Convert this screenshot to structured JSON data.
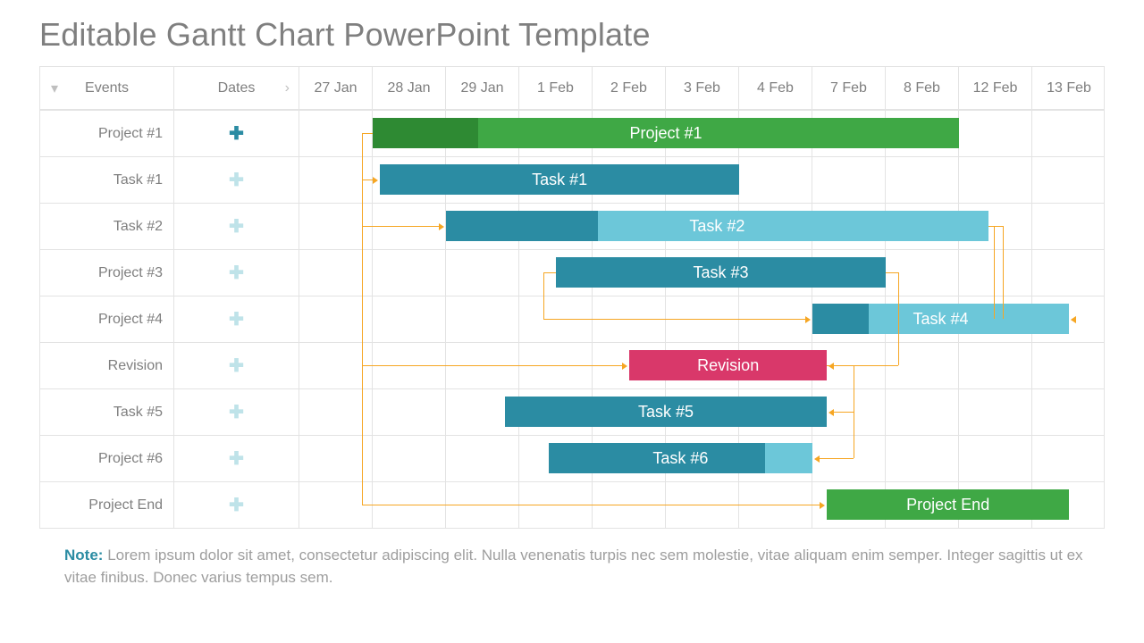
{
  "title": "Editable Gantt Chart PowerPoint Template",
  "headers": {
    "events": "Events",
    "dates": "Dates",
    "cols": [
      "27 Jan",
      "28 Jan",
      "29 Jan",
      "1 Feb",
      "2 Feb",
      "3 Feb",
      "4 Feb",
      "7 Feb",
      "8 Feb",
      "12 Feb",
      "13 Feb"
    ]
  },
  "rows": [
    {
      "label": "Project #1",
      "plus": "teal"
    },
    {
      "label": "Task #1",
      "plus": "light"
    },
    {
      "label": "Task #2",
      "plus": "light"
    },
    {
      "label": "Project #3",
      "plus": "light"
    },
    {
      "label": "Project #4",
      "plus": "light"
    },
    {
      "label": "Revision",
      "plus": "light"
    },
    {
      "label": "Task #5",
      "plus": "light"
    },
    {
      "label": "Project #6",
      "plus": "light"
    },
    {
      "label": "Project End",
      "plus": "light"
    }
  ],
  "colors": {
    "green": "#3fa845",
    "green_dark": "#2e8a33",
    "teal": "#2b8ca3",
    "teal_light": "#6cc7d9",
    "magenta": "#d9386a",
    "orange": "#f6a623"
  },
  "chart_data": {
    "type": "bar",
    "title": "Editable Gantt Chart PowerPoint Template",
    "categories": [
      "27 Jan",
      "28 Jan",
      "29 Jan",
      "1 Feb",
      "2 Feb",
      "3 Feb",
      "4 Feb",
      "7 Feb",
      "8 Feb",
      "12 Feb",
      "13 Feb"
    ],
    "xlabel": "Dates",
    "ylabel": "Events",
    "series": [
      {
        "name": "Project #1",
        "row": 0,
        "start_col": 1.0,
        "end_col": 9.0,
        "label": "Project #1",
        "fill": "green",
        "progress_fill": "green_dark",
        "progress": 0.18
      },
      {
        "name": "Task #1",
        "row": 1,
        "start_col": 1.1,
        "end_col": 6.0,
        "label": "Task #1",
        "fill": "teal"
      },
      {
        "name": "Task #2",
        "row": 2,
        "start_col": 2.0,
        "end_col": 9.4,
        "label": "Task #2",
        "fill": "teal_light",
        "progress_fill": "teal",
        "progress": 0.28
      },
      {
        "name": "Task #3",
        "row": 3,
        "start_col": 3.5,
        "end_col": 8.0,
        "label": "Task #3",
        "fill": "teal"
      },
      {
        "name": "Task #4",
        "row": 4,
        "start_col": 7.0,
        "end_col": 10.5,
        "label": "Task #4",
        "fill": "teal_light",
        "progress_fill": "teal",
        "progress": 0.22
      },
      {
        "name": "Revision",
        "row": 5,
        "start_col": 4.5,
        "end_col": 7.2,
        "label": "Revision",
        "fill": "magenta"
      },
      {
        "name": "Task #5",
        "row": 6,
        "start_col": 2.8,
        "end_col": 7.2,
        "label": "Task #5",
        "fill": "teal"
      },
      {
        "name": "Task #6",
        "row": 7,
        "start_col": 3.4,
        "end_col": 7.0,
        "label": "Task #6",
        "fill": "teal",
        "overlay_fill": "teal_light",
        "overlay_from": 0.82
      },
      {
        "name": "Project End",
        "row": 8,
        "start_col": 7.2,
        "end_col": 10.5,
        "label": "Project End",
        "fill": "green"
      }
    ],
    "dependencies": [
      {
        "from": "Project #1:start",
        "to": "Task #1:start"
      },
      {
        "from": "Project #1:start",
        "to": "Task #2:start"
      },
      {
        "from": "Project #1:start",
        "to": "Revision:start"
      },
      {
        "from": "Project #1:start",
        "to": "Project End:start"
      },
      {
        "from": "Task #2:end",
        "to": "Task #4:end"
      },
      {
        "from": "Task #3:start",
        "to": "Task #4:start"
      },
      {
        "from": "Task #3:end",
        "to": "Revision:end"
      },
      {
        "from": "Revision:end",
        "to": "Task #5:end"
      },
      {
        "from": "Revision:end",
        "to": "Task #6:end"
      }
    ]
  },
  "note_label": "Note:",
  "note_body": "Lorem ipsum dolor sit amet, consectetur adipiscing elit. Nulla venenatis turpis nec sem molestie, vitae aliquam enim semper. Integer sagittis ut ex vitae finibus. Donec varius tempus sem."
}
